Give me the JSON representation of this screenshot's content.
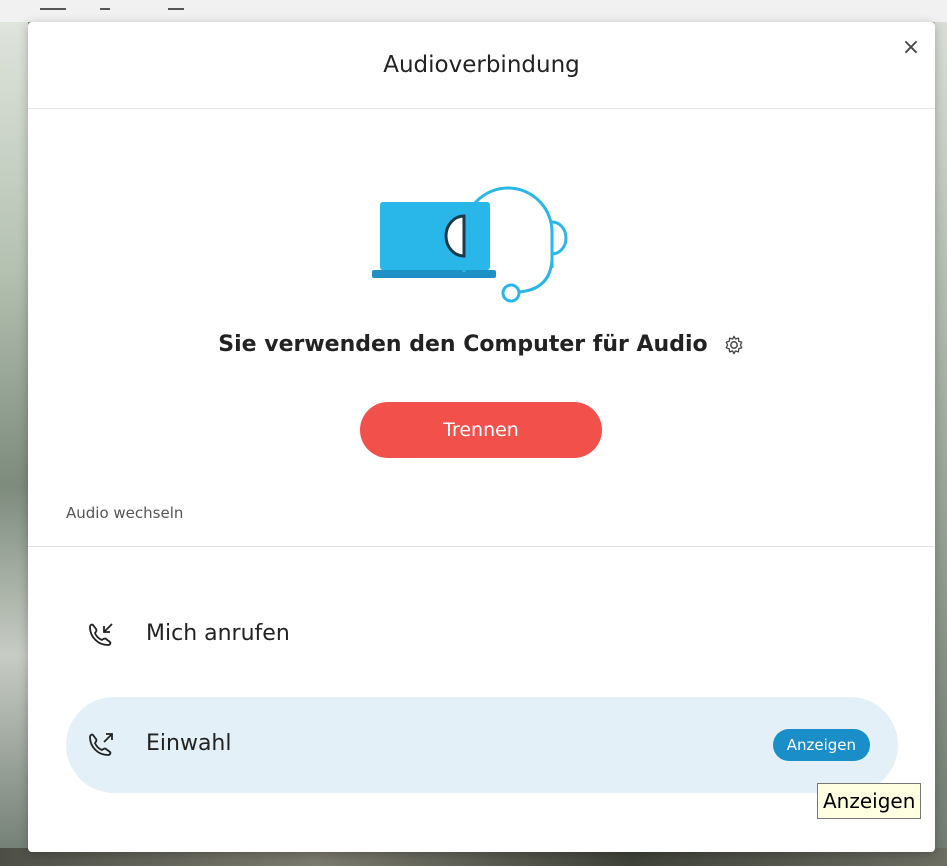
{
  "dialog": {
    "title": "Audioverbindung",
    "close_symbol": "×",
    "illustration": "laptop-headset-icon",
    "status_text": "Sie verwenden den Computer für Audio",
    "settings_icon": "gear-icon",
    "disconnect_label": "Trennen",
    "switch_audio_label": "Audio wechseln",
    "options": [
      {
        "label": "Mich anrufen",
        "icon": "phone-incoming-icon"
      },
      {
        "label": "Einwahl",
        "icon": "phone-outgoing-icon",
        "action_label": "Anzeigen"
      }
    ]
  },
  "tooltip": {
    "text": "Anzeigen"
  },
  "colors": {
    "accent_blue": "#1a8ec9",
    "illustration_blue": "#29b6e8",
    "disconnect_red": "#f2504b",
    "selected_row_bg": "#e3f0f7"
  }
}
